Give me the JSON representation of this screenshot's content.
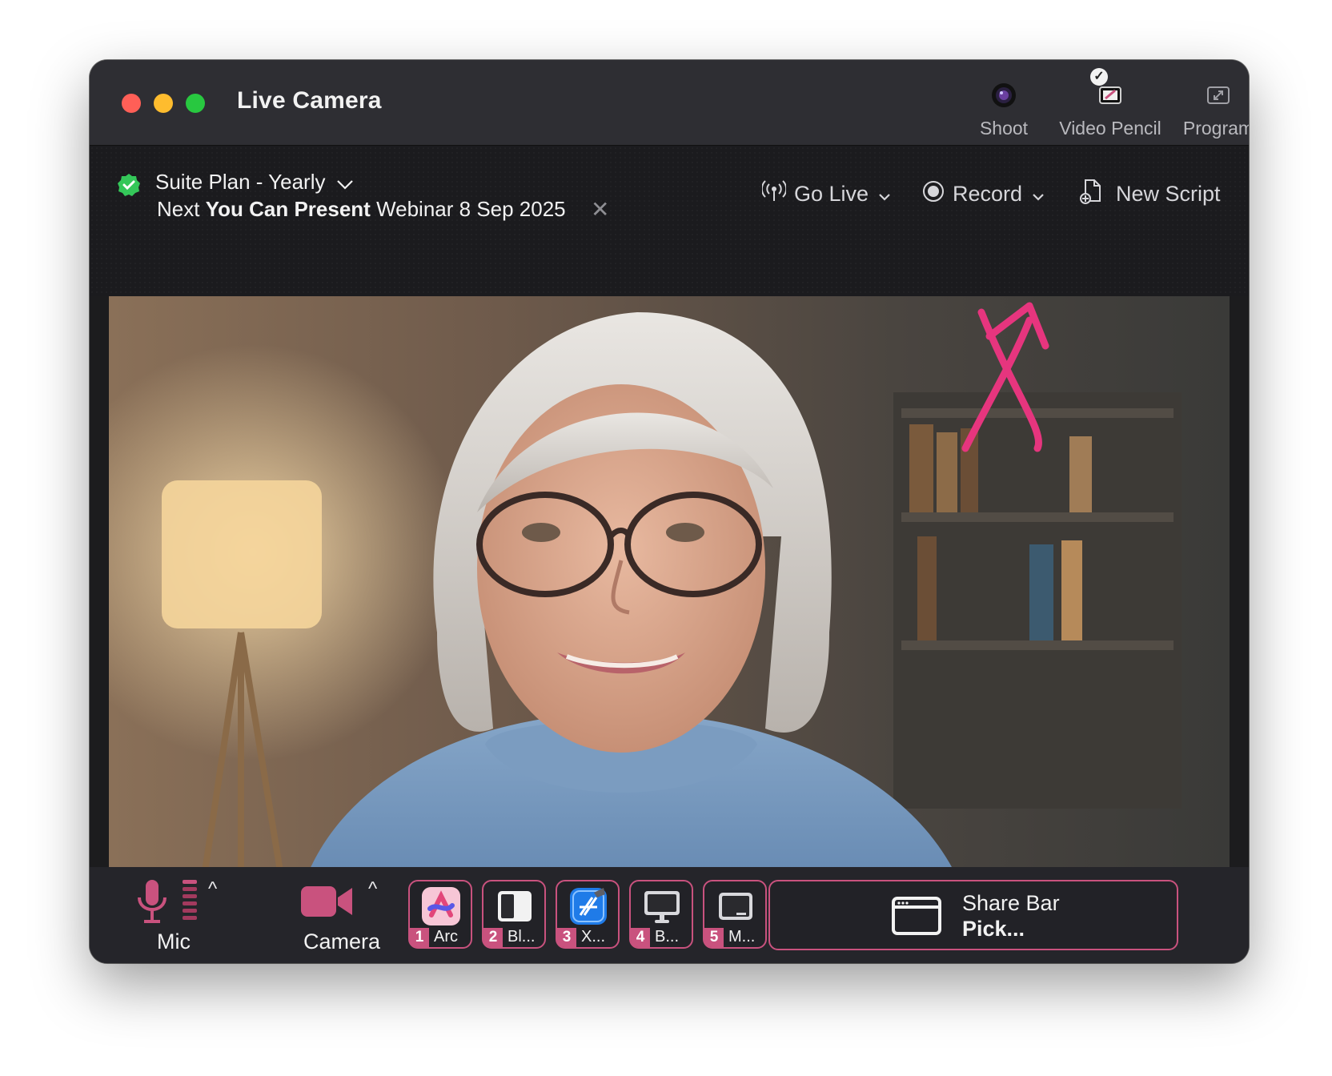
{
  "window": {
    "title": "Live Camera"
  },
  "toolbar": {
    "shoot_label": "Shoot",
    "video_pencil_label": "Video Pencil",
    "program_label": "Program"
  },
  "plan": {
    "name": "Suite Plan - Yearly",
    "next_prefix": "Next",
    "next_event_bold": "You Can Present",
    "next_event_rest": "Webinar 8 Sep 2025",
    "close_glyph": "✕"
  },
  "actions": {
    "go_live": "Go Live",
    "record": "Record",
    "new_script": "New Script"
  },
  "controls": {
    "mic_label": "Mic",
    "camera_label": "Camera",
    "caret_glyph": "^"
  },
  "apps": [
    {
      "num": "1",
      "name": "Arc",
      "icon": "arc-app-icon"
    },
    {
      "num": "2",
      "name": "Bl...",
      "icon": "split-window-icon"
    },
    {
      "num": "3",
      "name": "X...",
      "icon": "xcode-app-icon"
    },
    {
      "num": "4",
      "name": "B...",
      "icon": "monitor-icon"
    },
    {
      "num": "5",
      "name": "M...",
      "icon": "display-icon"
    }
  ],
  "share_bar": {
    "title": "Share Bar",
    "subtitle": "Pick..."
  },
  "colors": {
    "accent": "#c9527e",
    "annotation_arrow": "#e6357e",
    "plan_check": "#34c759"
  }
}
